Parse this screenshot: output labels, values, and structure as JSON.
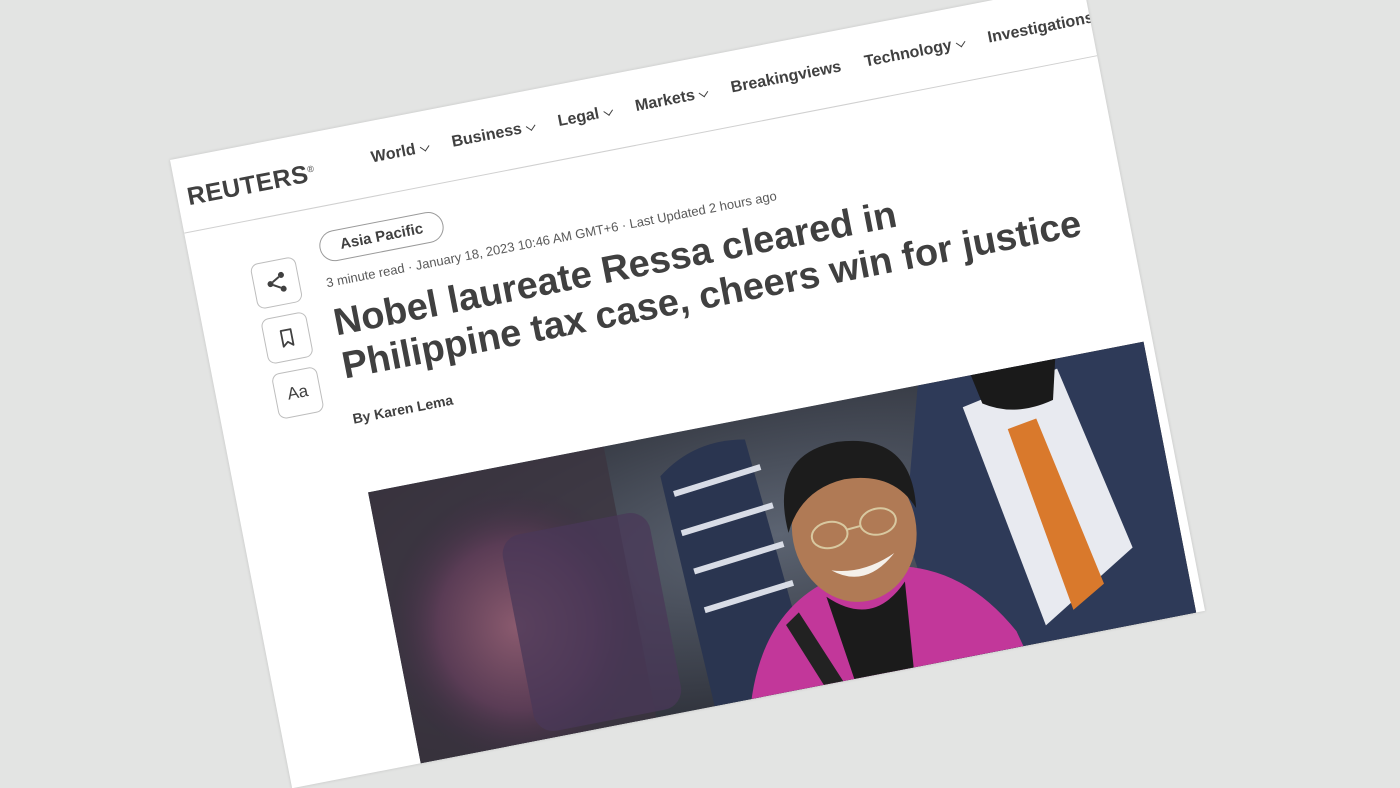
{
  "site": {
    "logo": "REUTERS",
    "logo_mark": "®"
  },
  "nav": {
    "items": [
      {
        "label": "World",
        "has_dropdown": true
      },
      {
        "label": "Business",
        "has_dropdown": true
      },
      {
        "label": "Legal",
        "has_dropdown": true
      },
      {
        "label": "Markets",
        "has_dropdown": true
      },
      {
        "label": "Breakingviews",
        "has_dropdown": false
      },
      {
        "label": "Technology",
        "has_dropdown": true
      },
      {
        "label": "Investigations",
        "has_dropdown": false
      }
    ]
  },
  "tools": {
    "share_icon": "share-icon",
    "bookmark_icon": "bookmark-icon",
    "text_size_label": "Aa"
  },
  "article": {
    "category": "Asia Pacific",
    "meta": "3 minute read · January 18, 2023 10:46 AM GMT+6 · Last Updated 2 hours ago",
    "headline": "Nobel laureate Ressa cleared in Philippine tax case, cheers win for justice",
    "byline": "By Karen Lema"
  },
  "colors": {
    "background": "#e3e4e3",
    "text": "#404040",
    "jacket": "#c2379a",
    "tie": "#d9792c"
  }
}
